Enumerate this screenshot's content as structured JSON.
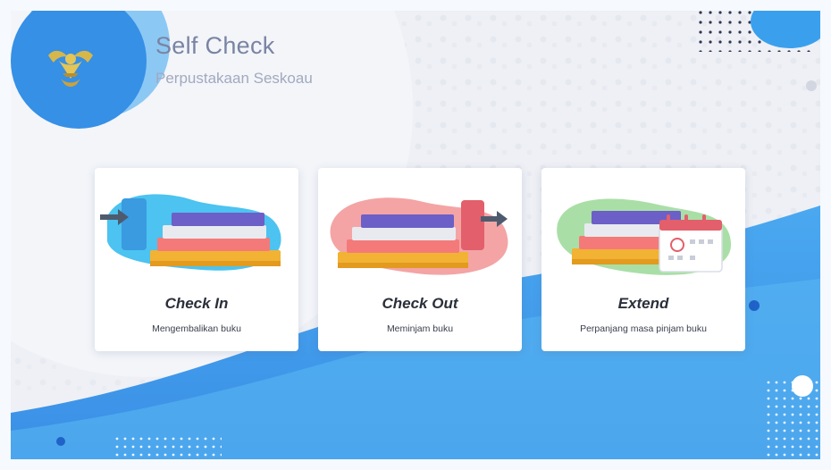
{
  "header": {
    "title": "Self Check",
    "subtitle": "Perpustakaan Seskoau",
    "logo_icon": "eagle-emblem-icon"
  },
  "cards": [
    {
      "title": "Check In",
      "subtitle": "Mengembalikan buku",
      "icon": "book-return-icon",
      "accent": "#4cc3f0"
    },
    {
      "title": "Check Out",
      "subtitle": "Meminjam buku",
      "icon": "book-borrow-icon",
      "accent": "#f4a4a4"
    },
    {
      "title": "Extend",
      "subtitle": "Perpanjang masa pinjam buku",
      "icon": "calendar-extend-icon",
      "accent": "#a9dfa6"
    }
  ],
  "colors": {
    "primary_blue": "#2f8de4",
    "light_blue": "#5fb8f0",
    "title_grey": "#7a84a3",
    "background": "#eef0f5"
  }
}
